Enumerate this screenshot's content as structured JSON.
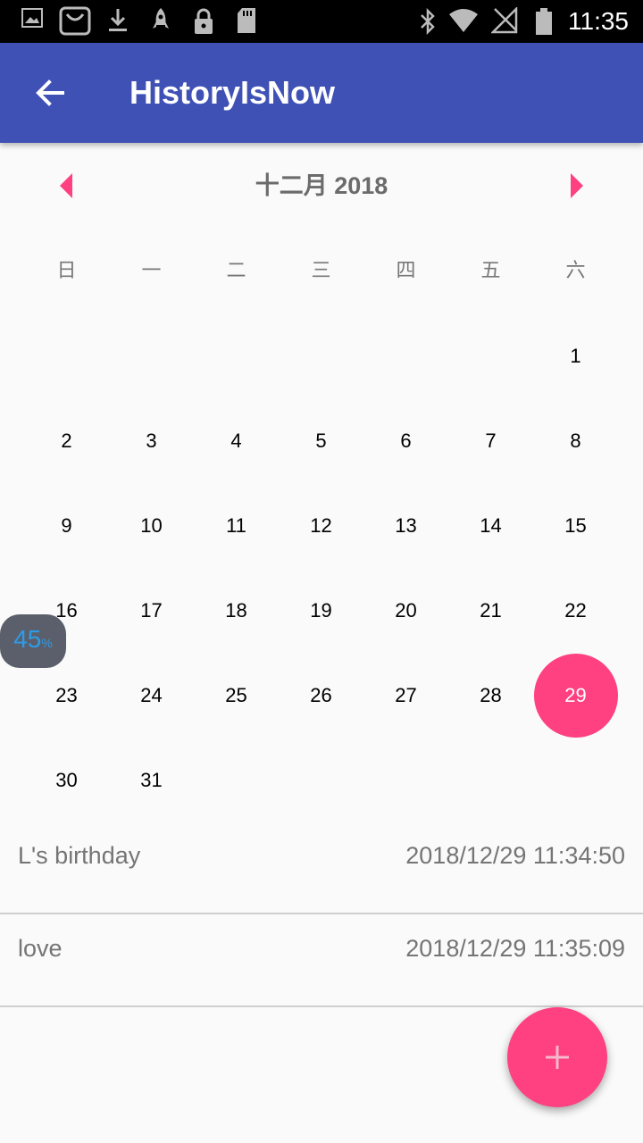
{
  "status_bar": {
    "time": "11:35",
    "left_icons": [
      "image-icon",
      "shopping-bag-icon",
      "download-icon",
      "rocket-icon",
      "lock-icon",
      "sd-card-icon"
    ],
    "right_icons": [
      "bluetooth-icon",
      "wifi-icon",
      "no-signal-icon",
      "battery-icon"
    ]
  },
  "app_bar": {
    "title": "HistoryIsNow",
    "back_icon": "arrow-back-icon",
    "color": "#3f51b5"
  },
  "calendar": {
    "month_title": "十二月 2018",
    "weekdays": [
      "日",
      "一",
      "二",
      "三",
      "四",
      "五",
      "六"
    ],
    "weeks": [
      [
        "",
        "",
        "",
        "",
        "",
        "",
        "1"
      ],
      [
        "2",
        "3",
        "4",
        "5",
        "6",
        "7",
        "8"
      ],
      [
        "9",
        "10",
        "11",
        "12",
        "13",
        "14",
        "15"
      ],
      [
        "16",
        "17",
        "18",
        "19",
        "20",
        "21",
        "22"
      ],
      [
        "23",
        "24",
        "25",
        "26",
        "27",
        "28",
        "29"
      ],
      [
        "30",
        "31",
        "",
        "",
        "",
        "",
        ""
      ]
    ],
    "selected_day": "29",
    "accent": "#ff4081"
  },
  "events": [
    {
      "title": "L's  birthday",
      "time": "2018/12/29 11:34:50"
    },
    {
      "title": "love",
      "time": "2018/12/29 11:35:09"
    }
  ],
  "fab": {
    "icon": "plus-icon"
  },
  "overlay": {
    "value": "45",
    "unit": "%"
  }
}
